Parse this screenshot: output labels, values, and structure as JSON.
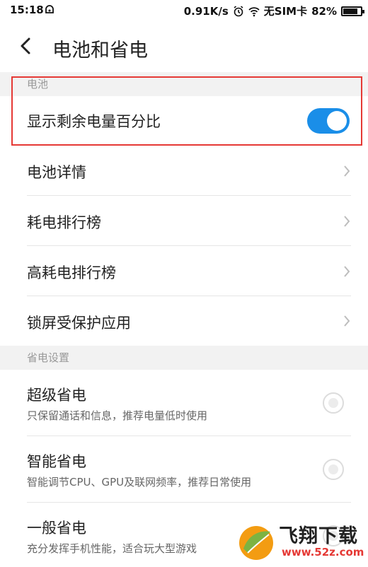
{
  "status_bar": {
    "time": "15:18",
    "network_speed": "0.91K/s",
    "sim_status": "无SIM卡",
    "battery_percent": "82%",
    "battery_level": 0.82,
    "icons": [
      "notification-icon",
      "alarm-icon",
      "wifi-icon",
      "battery-icon"
    ]
  },
  "header": {
    "title": "电池和省电",
    "back_icon": "back-arrow-icon"
  },
  "battery_section": {
    "header": "电池",
    "show_percentage": {
      "label": "显示剩余电量百分比",
      "enabled": true
    },
    "items": [
      {
        "label": "电池详情"
      },
      {
        "label": "耗电排行榜"
      },
      {
        "label": "高耗电排行榜"
      },
      {
        "label": "锁屏受保护应用"
      }
    ]
  },
  "power_section": {
    "header": "省电设置",
    "modes": [
      {
        "label": "超级省电",
        "desc": "只保留通话和信息，推荐电量低时使用",
        "selected": false
      },
      {
        "label": "智能省电",
        "desc": "智能调节CPU、GPU及联网频率，推荐日常使用",
        "selected": false
      },
      {
        "label": "一般省电",
        "desc": "充分发挥手机性能，适合玩大型游戏",
        "selected": false
      }
    ]
  },
  "watermark": {
    "text": "飞翔下载",
    "url": "www.52z.com"
  },
  "colors": {
    "accent": "#1a8ee8",
    "highlight_border": "#e53935",
    "section_bg": "#f2f2f2"
  }
}
